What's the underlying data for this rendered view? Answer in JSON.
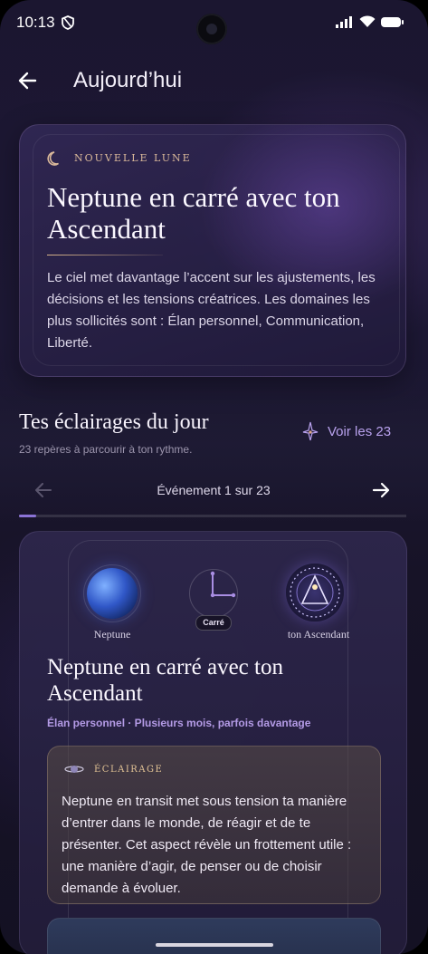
{
  "status_bar": {
    "time": "10:13"
  },
  "header": {
    "title": "Aujourd’hui"
  },
  "hero": {
    "tag": "NOUVELLE LUNE",
    "title": "Neptune en carré avec ton Ascendant",
    "text": "Le ciel met davantage l’accent sur les ajustements, les décisions et les tensions créatrices. Les domaines les plus sollicités sont : Élan personnel, Communication, Liberté."
  },
  "section": {
    "title": "Tes éclairages du jour",
    "subtitle": "23 repères à parcourir à ton rythme.",
    "see_all_label": "Voir les 23"
  },
  "pager": {
    "label": "Événement 1 sur 23",
    "progress": 0.045
  },
  "event": {
    "planet_left_label": "Neptune",
    "aspect_label": "Carré",
    "planet_right_label": "ton Ascendant",
    "title": "Neptune en carré avec ton Ascendant",
    "meta": "Élan personnel · Plusieurs mois, parfois davantage",
    "insight_tag": "ÉCLAIRAGE",
    "insight_text": "Neptune en transit met sous tension ta manière d’entrer dans le monde, de réagir et de te présenter. Cet aspect révèle un frottement utile : une manière d’agir, de penser ou de choisir demande à évoluer."
  },
  "colors": {
    "accent": "#b9a2ee",
    "gold": "#d9b89a",
    "background": "#1b1630"
  }
}
